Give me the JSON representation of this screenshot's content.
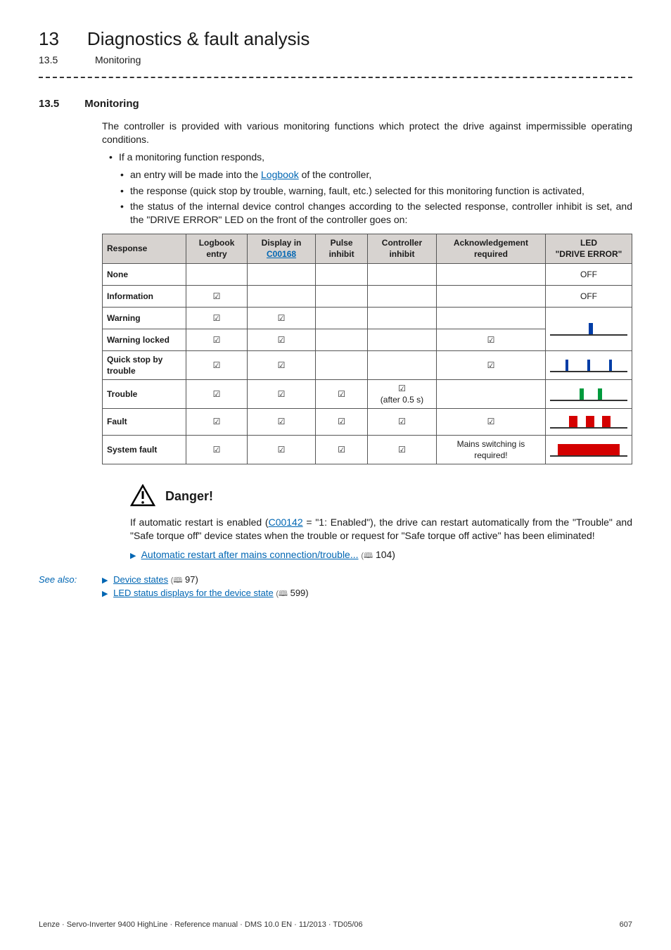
{
  "header": {
    "chapter_num": "13",
    "chapter_title": "Diagnostics & fault analysis",
    "sub_num": "13.5",
    "sub_title": "Monitoring"
  },
  "section": {
    "num": "13.5",
    "title": "Monitoring"
  },
  "intro": "The controller is provided with various monitoring functions which protect the drive against impermissible operating conditions.",
  "bullet1": "If a monitoring function responds,",
  "sub_a_pre": "an entry will be made into the ",
  "sub_a_link": "Logbook",
  "sub_a_post": " of the controller,",
  "sub_b": "the response (quick stop by trouble, warning, fault, etc.) selected for this monitoring function is activated,",
  "sub_c": "the status of the internal device control changes according to the selected response, controller inhibit is set, and the \"DRIVE ERROR\" LED on the front of the controller goes on:",
  "table": {
    "headers": {
      "c0": "Response",
      "c1": "Logbook entry",
      "c2_pre": "Display in ",
      "c2_link": "C00168",
      "c3": "Pulse inhibit",
      "c4": "Controller inhibit",
      "c5": "Acknowledgement required",
      "c6": "LED\n\"DRIVE ERROR\""
    },
    "rows": [
      {
        "r": "None",
        "log": "",
        "disp": "",
        "pi": "",
        "ci": "",
        "ack": "",
        "led_text": "OFF",
        "led": "off"
      },
      {
        "r": "Information",
        "log": "☑",
        "disp": "",
        "pi": "",
        "ci": "",
        "ack": "",
        "led_text": "OFF",
        "led": "off"
      },
      {
        "r": "Warning",
        "log": "☑",
        "disp": "☑",
        "pi": "",
        "ci": "",
        "ack": "",
        "led": "single"
      },
      {
        "r": "Warning locked",
        "log": "☑",
        "disp": "☑",
        "pi": "",
        "ci": "",
        "ack": "☑",
        "led": "merge_up"
      },
      {
        "r": "Quick stop by trouble",
        "log": "☑",
        "disp": "☑",
        "pi": "",
        "ci": "",
        "ack": "☑",
        "led": "triple_short"
      },
      {
        "r": "Trouble",
        "log": "☑",
        "disp": "☑",
        "pi": "☑",
        "ci": "☑\n(after 0.5 s)",
        "ack": "",
        "led": "double_green"
      },
      {
        "r": "Fault",
        "log": "☑",
        "disp": "☑",
        "pi": "☑",
        "ci": "☑",
        "ack": "☑",
        "led": "triple_red"
      },
      {
        "r": "System fault",
        "log": "☑",
        "disp": "☑",
        "pi": "☑",
        "ci": "☑",
        "ack": "Mains switching is required!",
        "led": "solid_red"
      }
    ]
  },
  "danger": {
    "title": "Danger!",
    "p1_pre": "If automatic restart is enabled (",
    "p1_link": "C00142",
    "p1_post": " = \"1: Enabled\"), the drive can restart automatically from the \"Trouble\" and \"Safe torque off\" device states when the trouble or request for \"Safe torque off active\" has been eliminated!",
    "p2_link": "Automatic restart after mains connection/trouble...",
    "p2_page": " 104)"
  },
  "seealso": {
    "label": "See also:",
    "l1": "Device states",
    "l1_page": " 97)",
    "l2": "LED status displays for the device state",
    "l2_page": " 599)"
  },
  "footer": {
    "left": "Lenze · Servo-Inverter 9400 HighLine · Reference manual · DMS 10.0 EN · 11/2013 · TD05/06",
    "right": "607"
  }
}
